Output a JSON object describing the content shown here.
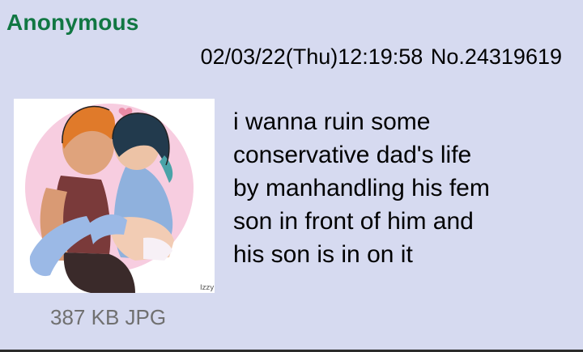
{
  "post": {
    "name": "Anonymous",
    "datetime": "02/03/22(Thu)12:19:58",
    "post_number": "No.24319619",
    "file": {
      "info": "387 KB JPG",
      "artist_signature": "Izzy"
    },
    "message_lines": [
      "i wanna ruin some",
      "conservative dad's life",
      "by manhandling his fem",
      "son in front of him and",
      "his son is in on it"
    ]
  },
  "colors": {
    "background": "#d6daf0",
    "name": "#117743",
    "fileinfo": "#707070"
  }
}
